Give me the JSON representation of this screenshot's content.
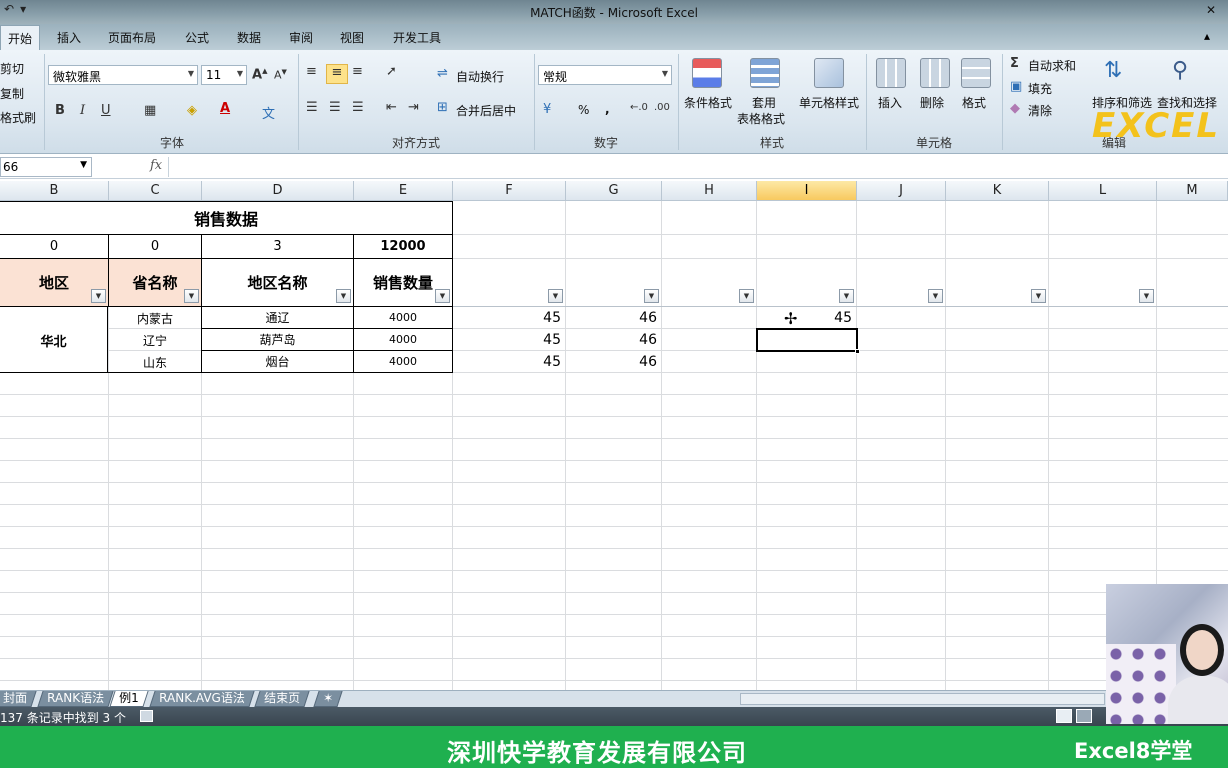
{
  "window": {
    "title": "MATCH函数 - Microsoft Excel",
    "qat_icons": [
      "undo-icon",
      "qat-dropdown-icon"
    ]
  },
  "ribbon_tabs": [
    "开始",
    "插入",
    "页面布局",
    "公式",
    "数据",
    "审阅",
    "视图",
    "开发工具"
  ],
  "clipboard": {
    "cut": "剪切",
    "copy": "复制",
    "format_painter": "格式刷"
  },
  "font": {
    "name": "微软雅黑",
    "size": "11",
    "group_label": "字体"
  },
  "alignment": {
    "wrap": "自动换行",
    "merge": "合并后居中",
    "group_label": "对齐方式"
  },
  "number": {
    "format": "常规",
    "percent": "%",
    "comma": ",",
    "group_label": "数字"
  },
  "styles": {
    "conditional": "条件格式",
    "table1": "套用",
    "table2": "表格格式",
    "cell_styles": "单元格样式",
    "group_label": "样式"
  },
  "cells": {
    "insert": "插入",
    "delete": "删除",
    "format": "格式",
    "group_label": "单元格"
  },
  "editing": {
    "autosum": "自动求和",
    "fill": "填充",
    "clear": "清除",
    "sort_filter": "排序和筛选",
    "find_select": "查找和选择",
    "group_label": "编辑"
  },
  "watermark": "EXCEL",
  "formula_bar": {
    "name_box": "66",
    "fx": "fx",
    "content": ""
  },
  "columns": [
    "B",
    "C",
    "D",
    "E",
    "F",
    "G",
    "H",
    "I",
    "J",
    "K",
    "L",
    "M"
  ],
  "selected_column": "I",
  "sheet": {
    "title": "销售数据",
    "counts": [
      "0",
      "0",
      "3",
      "12000"
    ],
    "headers": [
      "地区",
      "省名称",
      "地区名称",
      "销售数量"
    ],
    "region": "华北",
    "rows": [
      {
        "province": "内蒙古",
        "area": "通辽",
        "qty": "4000",
        "f": "45",
        "g": "46"
      },
      {
        "province": "辽宁",
        "area": "葫芦岛",
        "qty": "4000",
        "f": "45",
        "g": "46"
      },
      {
        "province": "山东",
        "area": "烟台",
        "qty": "4000",
        "f": "45",
        "g": "46"
      }
    ],
    "i_value": "45"
  },
  "sheet_tabs": [
    "封面",
    "RANK语法",
    "例1",
    "RANK.AVG语法",
    "结束页"
  ],
  "active_sheet_tab": "例1",
  "status": {
    "message": "137 条记录中找到 3 个"
  },
  "banner": {
    "company": "深圳快学教育发展有限公司",
    "brand": "Excel8学堂"
  }
}
